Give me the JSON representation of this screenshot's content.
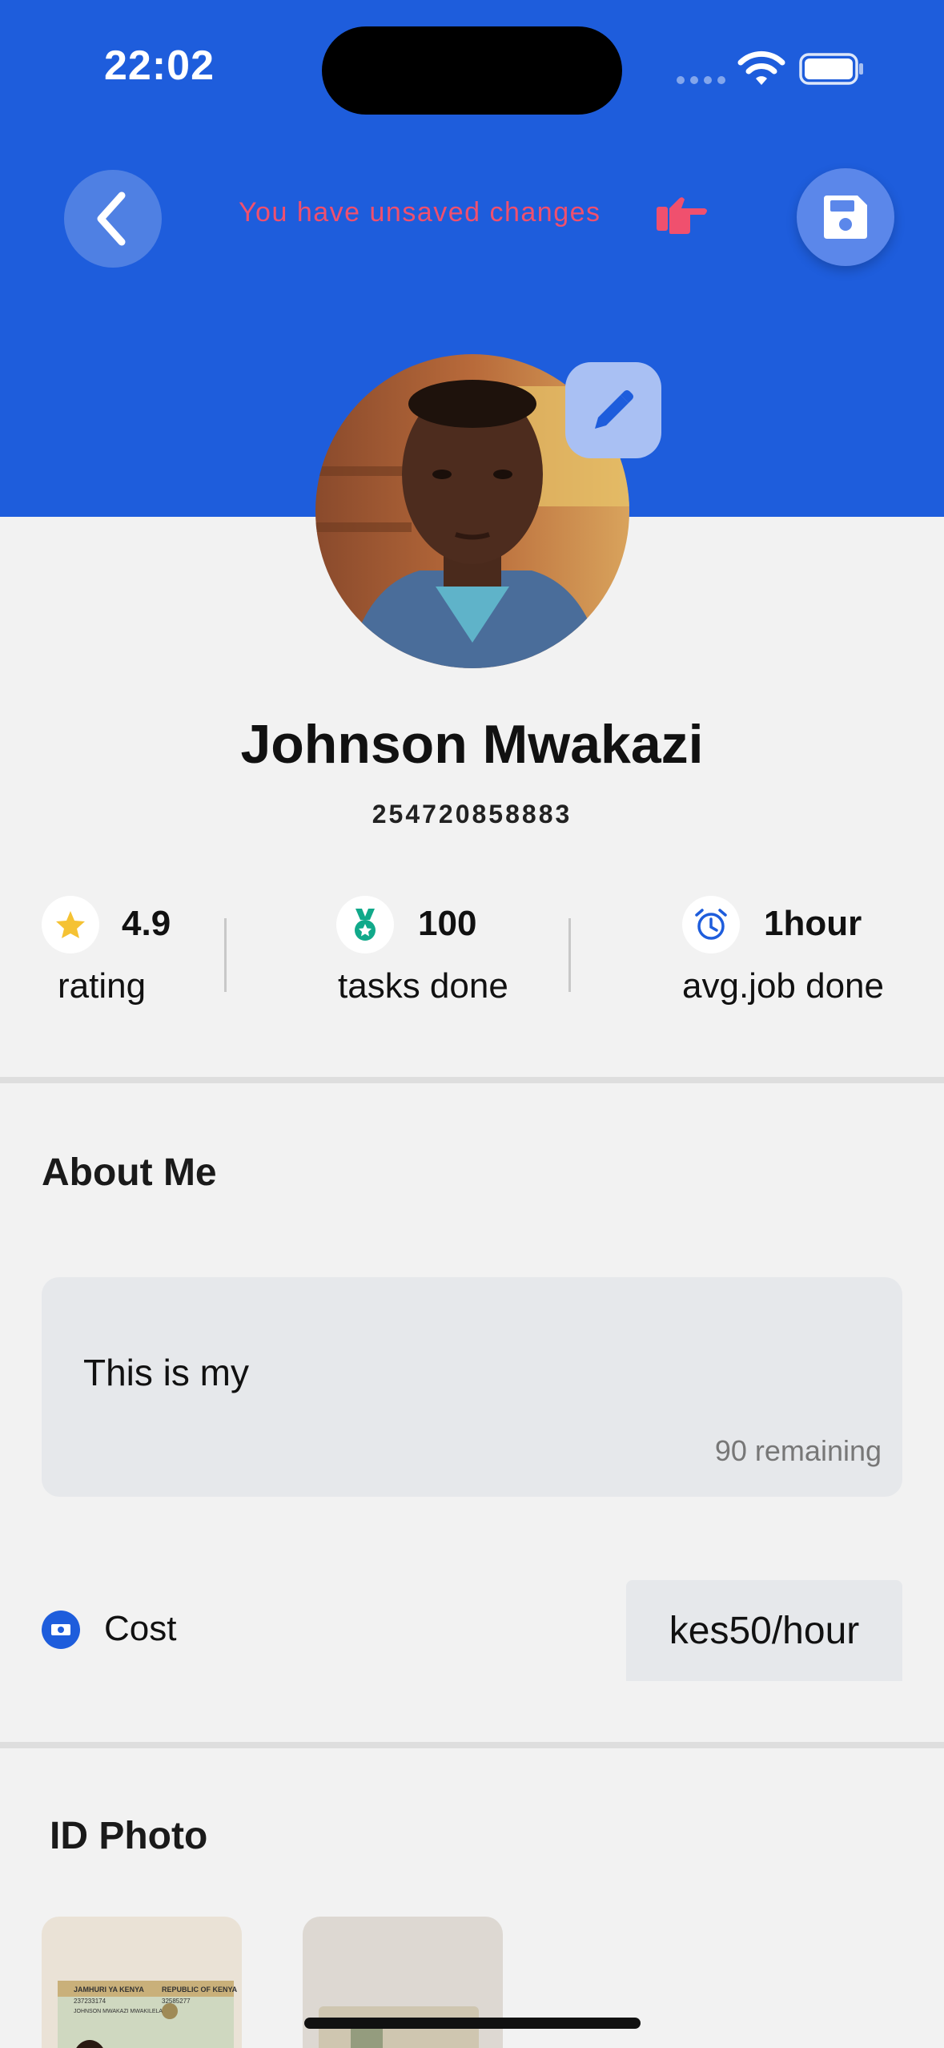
{
  "status_bar": {
    "time": "22:02"
  },
  "header": {
    "unsaved_message": "You have unsaved changes",
    "colors": {
      "brand": "#1e5ddc",
      "warning_text": "#f0506e"
    }
  },
  "profile": {
    "name": "Johnson Mwakazi",
    "phone": "254720858883"
  },
  "stats": [
    {
      "icon": "star-icon",
      "value": "4.9",
      "label": "rating",
      "color": "#f5c233"
    },
    {
      "icon": "medal-icon",
      "value": "100",
      "label": "tasks done",
      "color": "#11a98a"
    },
    {
      "icon": "alarm-clock-icon",
      "value": "1hour",
      "label": "avg.job done",
      "color": "#1e5ddc"
    }
  ],
  "about": {
    "title": "About Me",
    "text": "This is my",
    "remaining": "90 remaining"
  },
  "cost": {
    "label": "Cost",
    "value": "kes50/hour"
  },
  "id_photo": {
    "title": "ID Photo",
    "card_front_header_left": "JAMHURI YA KENYA",
    "card_front_header_right": "REPUBLIC OF KENYA",
    "card_front_number": "237233174",
    "card_front_serial": "32585277",
    "card_front_name": "JOHNSON MWAKAZI MWAKILELA"
  }
}
